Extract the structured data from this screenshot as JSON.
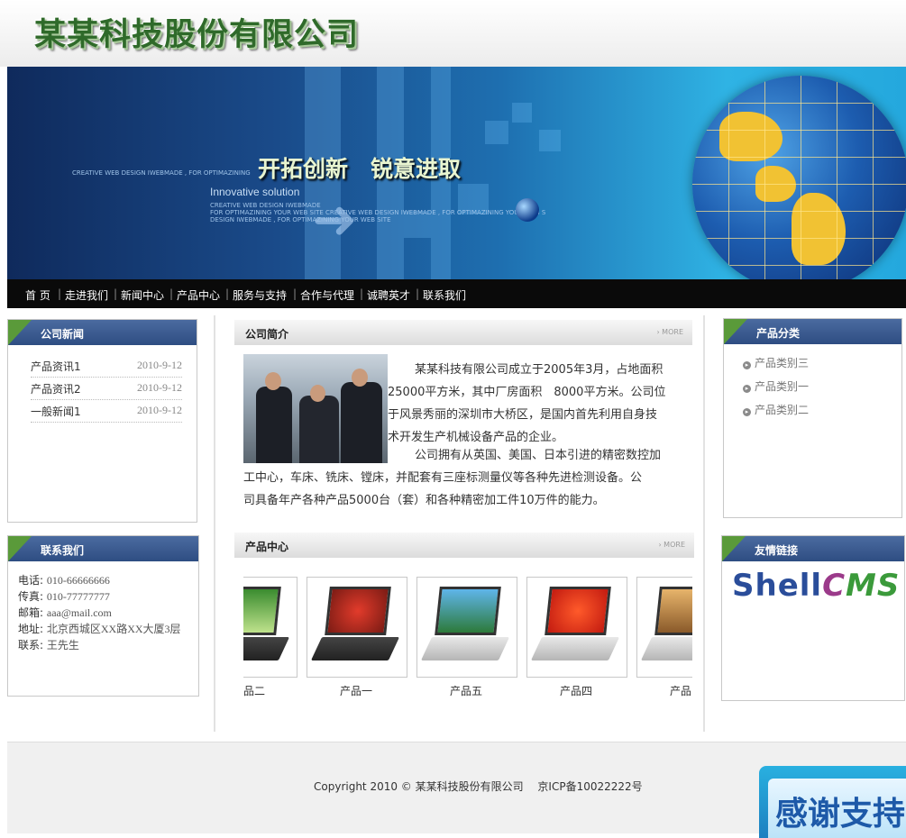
{
  "site": {
    "company_name": "某某科技股份有限公司"
  },
  "banner": {
    "slogan": "开拓创新　锐意进取",
    "tagline_small": "CREATIVE WEB DESIGN IWEBMADE , FOR OPTIMAZINING",
    "solution": "Innovative solution",
    "small_lines": [
      "CREATIVE WEB DESIGN IWEBMADE",
      "FOR OPTIMAZINING YOUR WEB SITE CREATIVE WEB DESIGN IWEBMADE , FOR OPTIMAZINING YOUR WEB S",
      "DESIGN IWEBMADE , FOR OPTIMAZINING YOUR WEB SITE"
    ]
  },
  "nav": {
    "items": [
      "首 页",
      "走进我们",
      "新闻中心",
      "产品中心",
      "服务与支持",
      "合作与代理",
      "诚聘英才",
      "联系我们"
    ]
  },
  "news": {
    "title": "公司新闻",
    "items": [
      {
        "title": "产品资讯1",
        "date": "2010-9-12"
      },
      {
        "title": "产品资讯2",
        "date": "2010-9-12"
      },
      {
        "title": "一般新闻1",
        "date": "2010-9-12"
      }
    ]
  },
  "contact": {
    "title": "联系我们",
    "lines": [
      {
        "label": "电话:",
        "value": "010-66666666"
      },
      {
        "label": "传真:",
        "value": "010-77777777"
      },
      {
        "label": "邮箱:",
        "value": "aaa@mail.com"
      },
      {
        "label": "地址:",
        "value": "北京西城区XX路XX大厦3层"
      },
      {
        "label": "联系:",
        "value": "王先生"
      }
    ]
  },
  "intro": {
    "title": "公司简介",
    "more": "› MORE",
    "lines": [
      "某某科技有限公司成立于2005年3月，占地面积",
      "25000平方米，其中厂房面积　8000平方米。公司位",
      "于风景秀丽的深圳市大桥区，是国内首先利用自身技",
      "术开发生产机械设备产品的企业。",
      "公司拥有从英国、美国、日本引进的精密数控加",
      "工中心，车床、铣床、镗床，并配套有三座标测量仪等各种先进检测设备。公",
      "司具备年产各种产品5000台（套）和各种精密加工件10万件的能力。"
    ]
  },
  "products": {
    "title": "产品中心",
    "more": "› MORE",
    "items": [
      "品二",
      "产品一",
      "产品五",
      "产品四",
      "产品"
    ]
  },
  "categories": {
    "title": "产品分类",
    "items": [
      "产品类别三",
      "产品类别一",
      "产品类别二"
    ]
  },
  "links": {
    "title": "友情链接",
    "logo_a": "Shell",
    "logo_b": "C",
    "logo_c": "MS"
  },
  "footer": {
    "copyright": "Copyright 2010 © 某某科技股份有限公司　 京ICP备10022222号",
    "thanks": "感谢支持"
  }
}
